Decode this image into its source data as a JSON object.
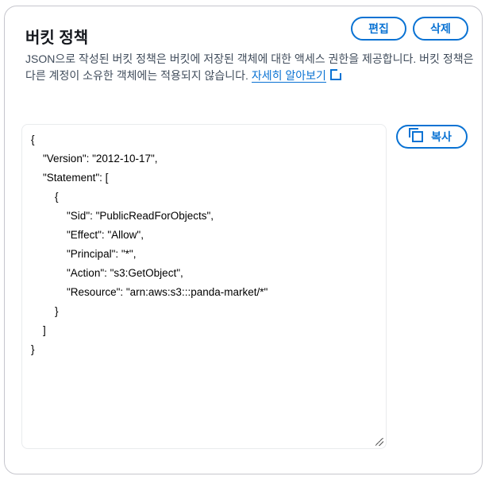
{
  "title": "버킷 정책",
  "buttons": {
    "edit": "편집",
    "delete": "삭제",
    "copy": "복사"
  },
  "description": "JSON으로 작성된 버킷 정책은 버킷에 저장된 객체에 대한 액세스 권한을 제공합니다. 버킷 정책은 다른 계정이 소유한 객체에는 적용되지 않습니다.",
  "learn_more": "자세히 알아보기",
  "policy_lines": [
    "{",
    "    \"Version\": \"2012-10-17\",",
    "    \"Statement\": [",
    "        {",
    "            \"Sid\": \"PublicReadForObjects\",",
    "            \"Effect\": \"Allow\",",
    "            \"Principal\": \"*\",",
    "            \"Action\": \"s3:GetObject\",",
    "            \"Resource\": \"arn:aws:s3:::panda-market/*\"",
    "        }",
    "    ]",
    "}"
  ]
}
